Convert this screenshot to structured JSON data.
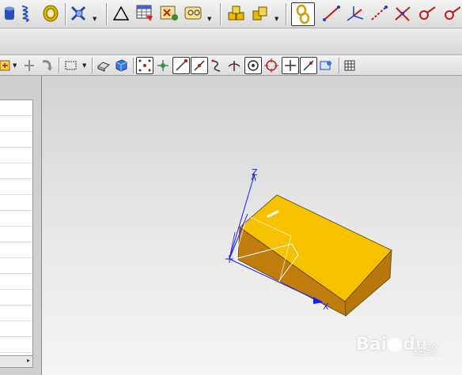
{
  "toolbar_top": {
    "icons": [
      "database-icon",
      "spring-icon",
      "coil-icon",
      "sketch-tools-icon",
      "triangle-icon",
      "table-icon",
      "grid-edit-icon",
      "point-set-icon",
      "assembly-icon",
      "component-icon",
      "component-add-icon",
      "chain-icon",
      "line-icon",
      "axis-icon",
      "dashed-line-icon",
      "intersect-line-icon",
      "arc-point-icon",
      "circle-line-icon"
    ]
  },
  "toolbar_bottom": {
    "icons": [
      "new-sketch-icon",
      "move-icon",
      "rotate-icon",
      "selection-box-icon",
      "view-orient-icon",
      "shaded-cube-icon",
      "snap-points-icon",
      "snap-grid-icon",
      "endpoint-icon",
      "midpoint-icon",
      "control-point-icon",
      "intersection-icon",
      "arc-center-icon",
      "quadrant-icon",
      "point-on-curve-icon",
      "existing-point-icon",
      "tangent-icon",
      "table-grid-icon"
    ]
  },
  "viewport": {
    "axis_z_label": "Z",
    "axis_x_label": "X",
    "block_color": "#f6c200",
    "block_side_color": "#b8770a",
    "axis_color": "#1a1aff"
  },
  "watermark": {
    "brand": "Bai",
    "brand2": "du",
    "sub": "经验"
  }
}
